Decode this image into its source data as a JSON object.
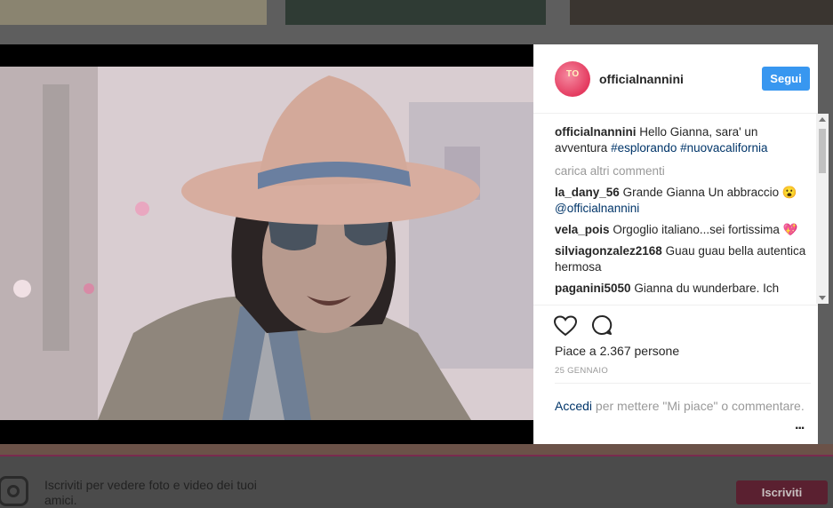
{
  "post": {
    "username": "officialnannini",
    "avatar_text": "TO",
    "follow_label": "Segui",
    "caption": {
      "user": "officialnannini",
      "text": "Hello Gianna, sara' un avventura",
      "tags": [
        "#esplorando",
        "#nuovacalifornia"
      ]
    },
    "load_more_label": "carica altri commenti",
    "comments": [
      {
        "user": "la_dany_56",
        "text": "Grande Gianna Un abbraccio 😮",
        "mention": "@officialnannini"
      },
      {
        "user": "vela_pois",
        "text": "Orgoglio italiano...sei fortissima 💖"
      },
      {
        "user": "silviagonzalez2168",
        "text": "Guau guau bella autentica hermosa"
      },
      {
        "user": "paganini5050",
        "text": "Gianna du wunderbare. Ich"
      }
    ],
    "likes_text": "Piace a 2.367 persone",
    "date": "25 GENNAIO",
    "login_link": "Accedi",
    "login_text": " per mettere \"Mi piace\" o commentare.",
    "more_label": "..."
  },
  "signup": {
    "text": "Iscriviti per vedere foto e video dei tuoi amici.",
    "button": "Iscriviti"
  },
  "colors": {
    "accent": "#3897f0",
    "link": "#003569",
    "muted": "#999999"
  },
  "icons": [
    "heart-icon",
    "comment-icon",
    "more-icon",
    "instagram-logo-icon"
  ]
}
